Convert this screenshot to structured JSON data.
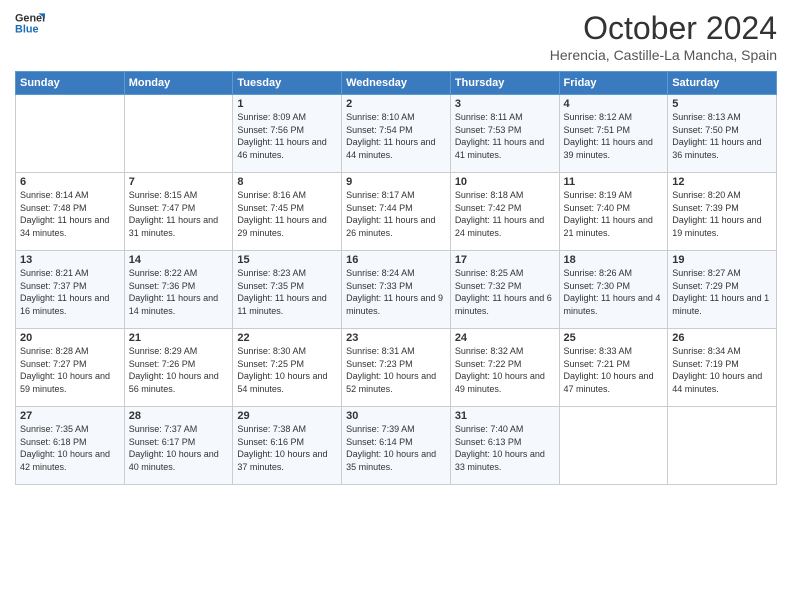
{
  "logo": {
    "line1": "General",
    "line2": "Blue"
  },
  "header": {
    "month": "October 2024",
    "location": "Herencia, Castille-La Mancha, Spain"
  },
  "days_of_week": [
    "Sunday",
    "Monday",
    "Tuesday",
    "Wednesday",
    "Thursday",
    "Friday",
    "Saturday"
  ],
  "weeks": [
    [
      {
        "day": "",
        "info": ""
      },
      {
        "day": "",
        "info": ""
      },
      {
        "day": "1",
        "info": "Sunrise: 8:09 AM\nSunset: 7:56 PM\nDaylight: 11 hours and 46 minutes."
      },
      {
        "day": "2",
        "info": "Sunrise: 8:10 AM\nSunset: 7:54 PM\nDaylight: 11 hours and 44 minutes."
      },
      {
        "day": "3",
        "info": "Sunrise: 8:11 AM\nSunset: 7:53 PM\nDaylight: 11 hours and 41 minutes."
      },
      {
        "day": "4",
        "info": "Sunrise: 8:12 AM\nSunset: 7:51 PM\nDaylight: 11 hours and 39 minutes."
      },
      {
        "day": "5",
        "info": "Sunrise: 8:13 AM\nSunset: 7:50 PM\nDaylight: 11 hours and 36 minutes."
      }
    ],
    [
      {
        "day": "6",
        "info": "Sunrise: 8:14 AM\nSunset: 7:48 PM\nDaylight: 11 hours and 34 minutes."
      },
      {
        "day": "7",
        "info": "Sunrise: 8:15 AM\nSunset: 7:47 PM\nDaylight: 11 hours and 31 minutes."
      },
      {
        "day": "8",
        "info": "Sunrise: 8:16 AM\nSunset: 7:45 PM\nDaylight: 11 hours and 29 minutes."
      },
      {
        "day": "9",
        "info": "Sunrise: 8:17 AM\nSunset: 7:44 PM\nDaylight: 11 hours and 26 minutes."
      },
      {
        "day": "10",
        "info": "Sunrise: 8:18 AM\nSunset: 7:42 PM\nDaylight: 11 hours and 24 minutes."
      },
      {
        "day": "11",
        "info": "Sunrise: 8:19 AM\nSunset: 7:40 PM\nDaylight: 11 hours and 21 minutes."
      },
      {
        "day": "12",
        "info": "Sunrise: 8:20 AM\nSunset: 7:39 PM\nDaylight: 11 hours and 19 minutes."
      }
    ],
    [
      {
        "day": "13",
        "info": "Sunrise: 8:21 AM\nSunset: 7:37 PM\nDaylight: 11 hours and 16 minutes."
      },
      {
        "day": "14",
        "info": "Sunrise: 8:22 AM\nSunset: 7:36 PM\nDaylight: 11 hours and 14 minutes."
      },
      {
        "day": "15",
        "info": "Sunrise: 8:23 AM\nSunset: 7:35 PM\nDaylight: 11 hours and 11 minutes."
      },
      {
        "day": "16",
        "info": "Sunrise: 8:24 AM\nSunset: 7:33 PM\nDaylight: 11 hours and 9 minutes."
      },
      {
        "day": "17",
        "info": "Sunrise: 8:25 AM\nSunset: 7:32 PM\nDaylight: 11 hours and 6 minutes."
      },
      {
        "day": "18",
        "info": "Sunrise: 8:26 AM\nSunset: 7:30 PM\nDaylight: 11 hours and 4 minutes."
      },
      {
        "day": "19",
        "info": "Sunrise: 8:27 AM\nSunset: 7:29 PM\nDaylight: 11 hours and 1 minute."
      }
    ],
    [
      {
        "day": "20",
        "info": "Sunrise: 8:28 AM\nSunset: 7:27 PM\nDaylight: 10 hours and 59 minutes."
      },
      {
        "day": "21",
        "info": "Sunrise: 8:29 AM\nSunset: 7:26 PM\nDaylight: 10 hours and 56 minutes."
      },
      {
        "day": "22",
        "info": "Sunrise: 8:30 AM\nSunset: 7:25 PM\nDaylight: 10 hours and 54 minutes."
      },
      {
        "day": "23",
        "info": "Sunrise: 8:31 AM\nSunset: 7:23 PM\nDaylight: 10 hours and 52 minutes."
      },
      {
        "day": "24",
        "info": "Sunrise: 8:32 AM\nSunset: 7:22 PM\nDaylight: 10 hours and 49 minutes."
      },
      {
        "day": "25",
        "info": "Sunrise: 8:33 AM\nSunset: 7:21 PM\nDaylight: 10 hours and 47 minutes."
      },
      {
        "day": "26",
        "info": "Sunrise: 8:34 AM\nSunset: 7:19 PM\nDaylight: 10 hours and 44 minutes."
      }
    ],
    [
      {
        "day": "27",
        "info": "Sunrise: 7:35 AM\nSunset: 6:18 PM\nDaylight: 10 hours and 42 minutes."
      },
      {
        "day": "28",
        "info": "Sunrise: 7:37 AM\nSunset: 6:17 PM\nDaylight: 10 hours and 40 minutes."
      },
      {
        "day": "29",
        "info": "Sunrise: 7:38 AM\nSunset: 6:16 PM\nDaylight: 10 hours and 37 minutes."
      },
      {
        "day": "30",
        "info": "Sunrise: 7:39 AM\nSunset: 6:14 PM\nDaylight: 10 hours and 35 minutes."
      },
      {
        "day": "31",
        "info": "Sunrise: 7:40 AM\nSunset: 6:13 PM\nDaylight: 10 hours and 33 minutes."
      },
      {
        "day": "",
        "info": ""
      },
      {
        "day": "",
        "info": ""
      }
    ]
  ]
}
